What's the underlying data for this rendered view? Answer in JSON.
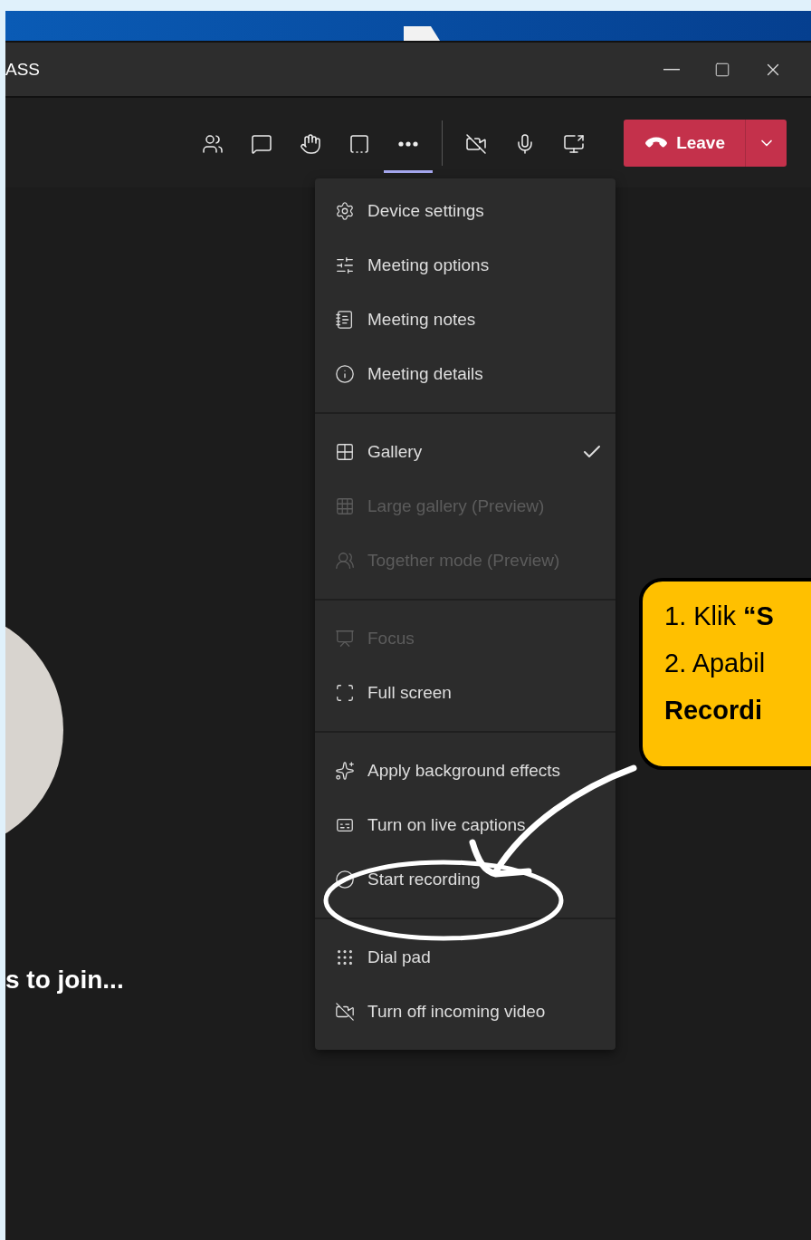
{
  "window": {
    "title": "ASS",
    "controls": [
      {
        "kind": "minimize"
      },
      {
        "kind": "maximize"
      },
      {
        "kind": "close"
      }
    ]
  },
  "toolbar": {
    "buttons": [
      {
        "kind": "people",
        "selected": false
      },
      {
        "kind": "chat",
        "selected": false
      },
      {
        "kind": "hand",
        "selected": false
      },
      {
        "kind": "rooms",
        "selected": false
      },
      {
        "kind": "more",
        "selected": true
      },
      {
        "kind": "camera",
        "selected": false
      },
      {
        "kind": "mic",
        "selected": false
      },
      {
        "kind": "share",
        "selected": false
      }
    ],
    "leave": {
      "label": "Leave"
    }
  },
  "menu": {
    "sections": [
      [
        {
          "kind": "gear",
          "label": "Device settings",
          "disabled": false,
          "checked": false
        },
        {
          "kind": "sliders",
          "label": "Meeting options",
          "disabled": false,
          "checked": false
        },
        {
          "kind": "notes",
          "label": "Meeting notes",
          "disabled": false,
          "checked": false
        },
        {
          "kind": "info",
          "label": "Meeting details",
          "disabled": false,
          "checked": false
        }
      ],
      [
        {
          "kind": "grid",
          "label": "Gallery",
          "disabled": false,
          "checked": true
        },
        {
          "kind": "grid3",
          "label": "Large gallery (Preview)",
          "disabled": true,
          "checked": false
        },
        {
          "kind": "group",
          "label": "Together mode (Preview)",
          "disabled": true,
          "checked": false
        }
      ],
      [
        {
          "kind": "focus",
          "label": "Focus",
          "disabled": true,
          "checked": false
        },
        {
          "kind": "fullscreen",
          "label": "Full screen",
          "disabled": false,
          "checked": false
        }
      ],
      [
        {
          "kind": "effects",
          "label": "Apply background effects",
          "disabled": false,
          "checked": false
        },
        {
          "kind": "captions",
          "label": "Turn on live captions",
          "disabled": false,
          "checked": false
        },
        {
          "kind": "record",
          "label": "Start recording",
          "disabled": false,
          "checked": false
        }
      ],
      [
        {
          "kind": "dialpad",
          "label": "Dial pad",
          "disabled": false,
          "checked": false
        },
        {
          "kind": "videooff",
          "label": "Turn off incoming video",
          "disabled": false,
          "checked": false
        }
      ]
    ]
  },
  "stage": {
    "status": "s to join..."
  },
  "callout": {
    "lines": [
      "1. Klik **“S**",
      "2. Apabil",
      "Recordi"
    ]
  }
}
